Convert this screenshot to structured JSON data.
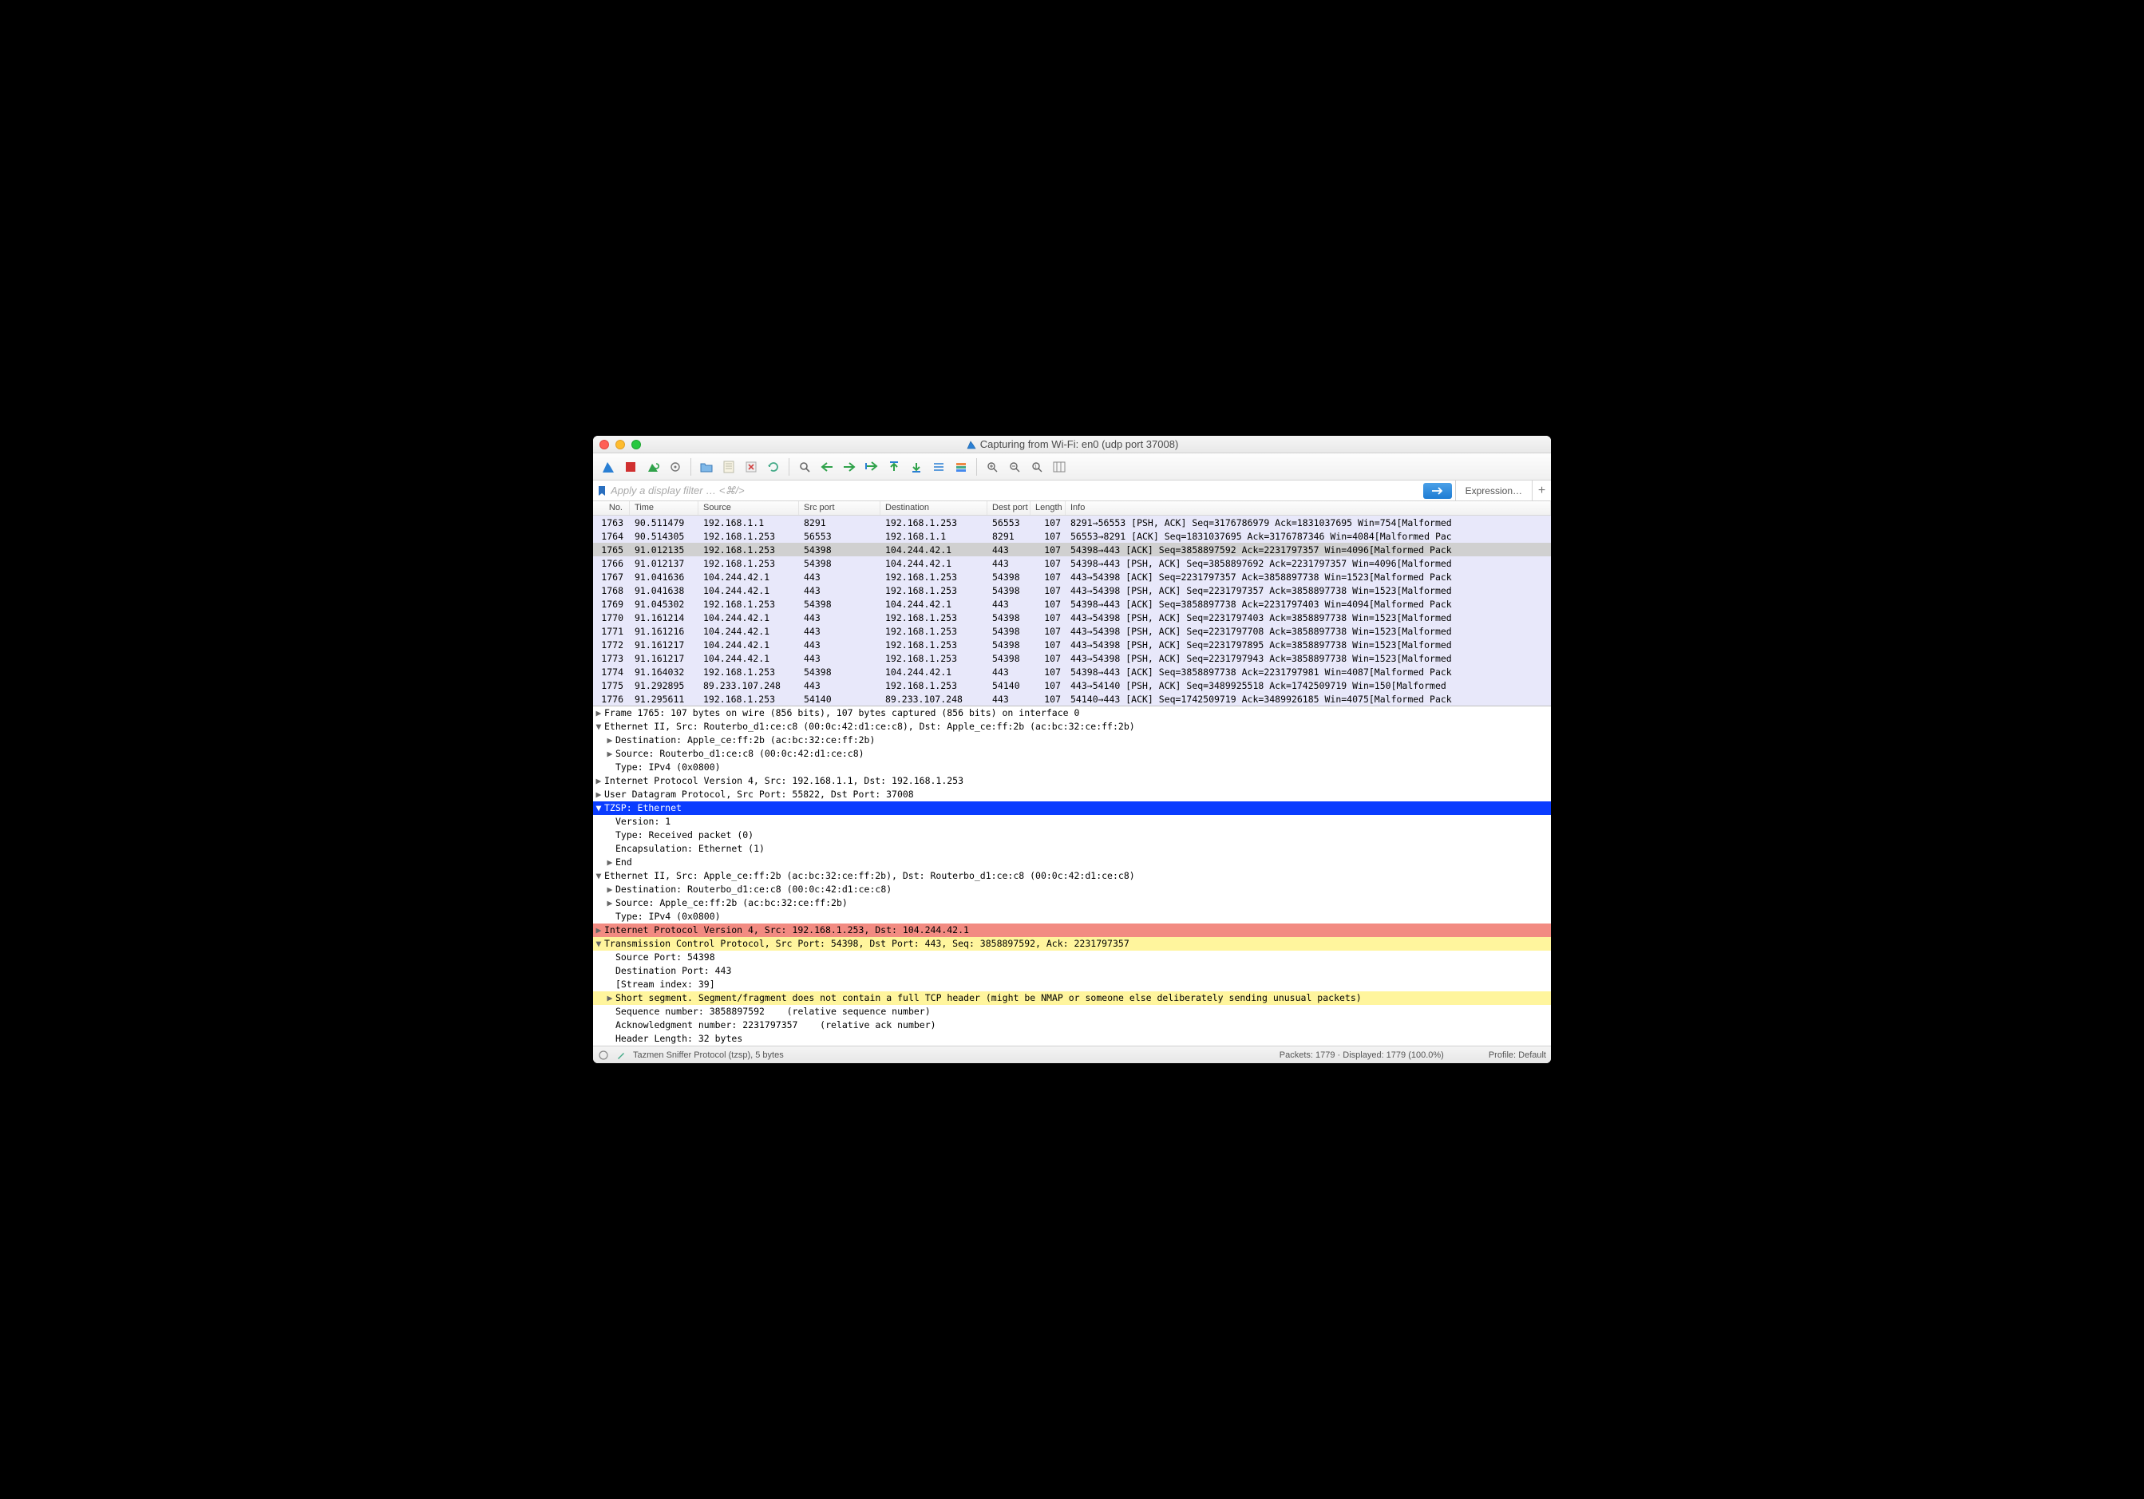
{
  "title": "Capturing from Wi-Fi: en0 (udp port 37008)",
  "filter_placeholder": "Apply a display filter … <⌘/>",
  "expression_label": "Expression…",
  "columns": {
    "no": "No.",
    "time": "Time",
    "src": "Source",
    "sport": "Src port",
    "dst": "Destination",
    "dport": "Dest port",
    "len": "Length",
    "info": "Info"
  },
  "packets": [
    {
      "no": "1763",
      "time": "90.511479",
      "src": "192.168.1.1",
      "sport": "8291",
      "dst": "192.168.1.253",
      "dport": "56553",
      "len": "107",
      "info": "8291→56553 [PSH, ACK] Seq=3176786979 Ack=1831037695 Win=754[Malformed",
      "cls": "lavender"
    },
    {
      "no": "1764",
      "time": "90.514305",
      "src": "192.168.1.253",
      "sport": "56553",
      "dst": "192.168.1.1",
      "dport": "8291",
      "len": "107",
      "info": "56553→8291 [ACK] Seq=1831037695 Ack=3176787346 Win=4084[Malformed Pac",
      "cls": "lavender"
    },
    {
      "no": "1765",
      "time": "91.012135",
      "src": "192.168.1.253",
      "sport": "54398",
      "dst": "104.244.42.1",
      "dport": "443",
      "len": "107",
      "info": "54398→443 [ACK] Seq=3858897592 Ack=2231797357 Win=4096[Malformed Pack",
      "cls": "selrow"
    },
    {
      "no": "1766",
      "time": "91.012137",
      "src": "192.168.1.253",
      "sport": "54398",
      "dst": "104.244.42.1",
      "dport": "443",
      "len": "107",
      "info": "54398→443 [PSH, ACK] Seq=3858897692 Ack=2231797357 Win=4096[Malformed",
      "cls": "lavender"
    },
    {
      "no": "1767",
      "time": "91.041636",
      "src": "104.244.42.1",
      "sport": "443",
      "dst": "192.168.1.253",
      "dport": "54398",
      "len": "107",
      "info": "443→54398 [ACK] Seq=2231797357 Ack=3858897738 Win=1523[Malformed Pack",
      "cls": "lavender"
    },
    {
      "no": "1768",
      "time": "91.041638",
      "src": "104.244.42.1",
      "sport": "443",
      "dst": "192.168.1.253",
      "dport": "54398",
      "len": "107",
      "info": "443→54398 [PSH, ACK] Seq=2231797357 Ack=3858897738 Win=1523[Malformed",
      "cls": "lavender"
    },
    {
      "no": "1769",
      "time": "91.045302",
      "src": "192.168.1.253",
      "sport": "54398",
      "dst": "104.244.42.1",
      "dport": "443",
      "len": "107",
      "info": "54398→443 [ACK] Seq=3858897738 Ack=2231797403 Win=4094[Malformed Pack",
      "cls": "lavender"
    },
    {
      "no": "1770",
      "time": "91.161214",
      "src": "104.244.42.1",
      "sport": "443",
      "dst": "192.168.1.253",
      "dport": "54398",
      "len": "107",
      "info": "443→54398 [PSH, ACK] Seq=2231797403 Ack=3858897738 Win=1523[Malformed",
      "cls": "lavender"
    },
    {
      "no": "1771",
      "time": "91.161216",
      "src": "104.244.42.1",
      "sport": "443",
      "dst": "192.168.1.253",
      "dport": "54398",
      "len": "107",
      "info": "443→54398 [PSH, ACK] Seq=2231797708 Ack=3858897738 Win=1523[Malformed",
      "cls": "lavender"
    },
    {
      "no": "1772",
      "time": "91.161217",
      "src": "104.244.42.1",
      "sport": "443",
      "dst": "192.168.1.253",
      "dport": "54398",
      "len": "107",
      "info": "443→54398 [PSH, ACK] Seq=2231797895 Ack=3858897738 Win=1523[Malformed",
      "cls": "lavender"
    },
    {
      "no": "1773",
      "time": "91.161217",
      "src": "104.244.42.1",
      "sport": "443",
      "dst": "192.168.1.253",
      "dport": "54398",
      "len": "107",
      "info": "443→54398 [PSH, ACK] Seq=2231797943 Ack=3858897738 Win=1523[Malformed",
      "cls": "lavender"
    },
    {
      "no": "1774",
      "time": "91.164032",
      "src": "192.168.1.253",
      "sport": "54398",
      "dst": "104.244.42.1",
      "dport": "443",
      "len": "107",
      "info": "54398→443 [ACK] Seq=3858897738 Ack=2231797981 Win=4087[Malformed Pack",
      "cls": "lavender"
    },
    {
      "no": "1775",
      "time": "91.292895",
      "src": "89.233.107.248",
      "sport": "443",
      "dst": "192.168.1.253",
      "dport": "54140",
      "len": "107",
      "info": "443→54140 [PSH, ACK] Seq=3489925518 Ack=1742509719 Win=150[Malformed",
      "cls": "lavender"
    },
    {
      "no": "1776",
      "time": "91.295611",
      "src": "192.168.1.253",
      "sport": "54140",
      "dst": "89.233.107.248",
      "dport": "443",
      "len": "107",
      "info": "54140→443 [ACK] Seq=1742509719 Ack=3489926185 Win=4075[Malformed Pack",
      "cls": "lavender"
    }
  ],
  "details": [
    {
      "indent": 0,
      "arrow": "▶",
      "text": "Frame 1765: 107 bytes on wire (856 bits), 107 bytes captured (856 bits) on interface 0",
      "cls": ""
    },
    {
      "indent": 0,
      "arrow": "▼",
      "text": "Ethernet II, Src: Routerbo_d1:ce:c8 (00:0c:42:d1:ce:c8), Dst: Apple_ce:ff:2b (ac:bc:32:ce:ff:2b)",
      "cls": ""
    },
    {
      "indent": 1,
      "arrow": "▶",
      "text": "Destination: Apple_ce:ff:2b (ac:bc:32:ce:ff:2b)",
      "cls": ""
    },
    {
      "indent": 1,
      "arrow": "▶",
      "text": "Source: Routerbo_d1:ce:c8 (00:0c:42:d1:ce:c8)",
      "cls": ""
    },
    {
      "indent": 1,
      "arrow": "",
      "text": "Type: IPv4 (0x0800)",
      "cls": ""
    },
    {
      "indent": 0,
      "arrow": "▶",
      "text": "Internet Protocol Version 4, Src: 192.168.1.1, Dst: 192.168.1.253",
      "cls": ""
    },
    {
      "indent": 0,
      "arrow": "▶",
      "text": "User Datagram Protocol, Src Port: 55822, Dst Port: 37008",
      "cls": ""
    },
    {
      "indent": 0,
      "arrow": "▼",
      "text": "TZSP: Ethernet",
      "cls": "hl-blue"
    },
    {
      "indent": 1,
      "arrow": "",
      "text": "Version: 1",
      "cls": ""
    },
    {
      "indent": 1,
      "arrow": "",
      "text": "Type: Received packet (0)",
      "cls": ""
    },
    {
      "indent": 1,
      "arrow": "",
      "text": "Encapsulation: Ethernet (1)",
      "cls": ""
    },
    {
      "indent": 1,
      "arrow": "▶",
      "text": "End",
      "cls": ""
    },
    {
      "indent": 0,
      "arrow": "▼",
      "text": "Ethernet II, Src: Apple_ce:ff:2b (ac:bc:32:ce:ff:2b), Dst: Routerbo_d1:ce:c8 (00:0c:42:d1:ce:c8)",
      "cls": ""
    },
    {
      "indent": 1,
      "arrow": "▶",
      "text": "Destination: Routerbo_d1:ce:c8 (00:0c:42:d1:ce:c8)",
      "cls": ""
    },
    {
      "indent": 1,
      "arrow": "▶",
      "text": "Source: Apple_ce:ff:2b (ac:bc:32:ce:ff:2b)",
      "cls": ""
    },
    {
      "indent": 1,
      "arrow": "",
      "text": "Type: IPv4 (0x0800)",
      "cls": ""
    },
    {
      "indent": 0,
      "arrow": "▶",
      "text": "Internet Protocol Version 4, Src: 192.168.1.253, Dst: 104.244.42.1",
      "cls": "hl-red"
    },
    {
      "indent": 0,
      "arrow": "▼",
      "text": "Transmission Control Protocol, Src Port: 54398, Dst Port: 443, Seq: 3858897592, Ack: 2231797357",
      "cls": "hl-yellow"
    },
    {
      "indent": 1,
      "arrow": "",
      "text": "Source Port: 54398",
      "cls": ""
    },
    {
      "indent": 1,
      "arrow": "",
      "text": "Destination Port: 443",
      "cls": ""
    },
    {
      "indent": 1,
      "arrow": "",
      "text": "[Stream index: 39]",
      "cls": ""
    },
    {
      "indent": 1,
      "arrow": "▶",
      "text": "Short segment. Segment/fragment does not contain a full TCP header (might be NMAP or someone else deliberately sending unusual packets)",
      "cls": "hl-yellow"
    },
    {
      "indent": 1,
      "arrow": "",
      "text": "Sequence number: 3858897592    (relative sequence number)",
      "cls": ""
    },
    {
      "indent": 1,
      "arrow": "",
      "text": "Acknowledgment number: 2231797357    (relative ack number)",
      "cls": ""
    },
    {
      "indent": 1,
      "arrow": "",
      "text": "Header Length: 32 bytes",
      "cls": ""
    }
  ],
  "status": {
    "protocol": "Tazmen Sniffer Protocol (tzsp), 5 bytes",
    "packets": "Packets: 1779 · Displayed: 1779 (100.0%)",
    "profile": "Profile: Default"
  }
}
